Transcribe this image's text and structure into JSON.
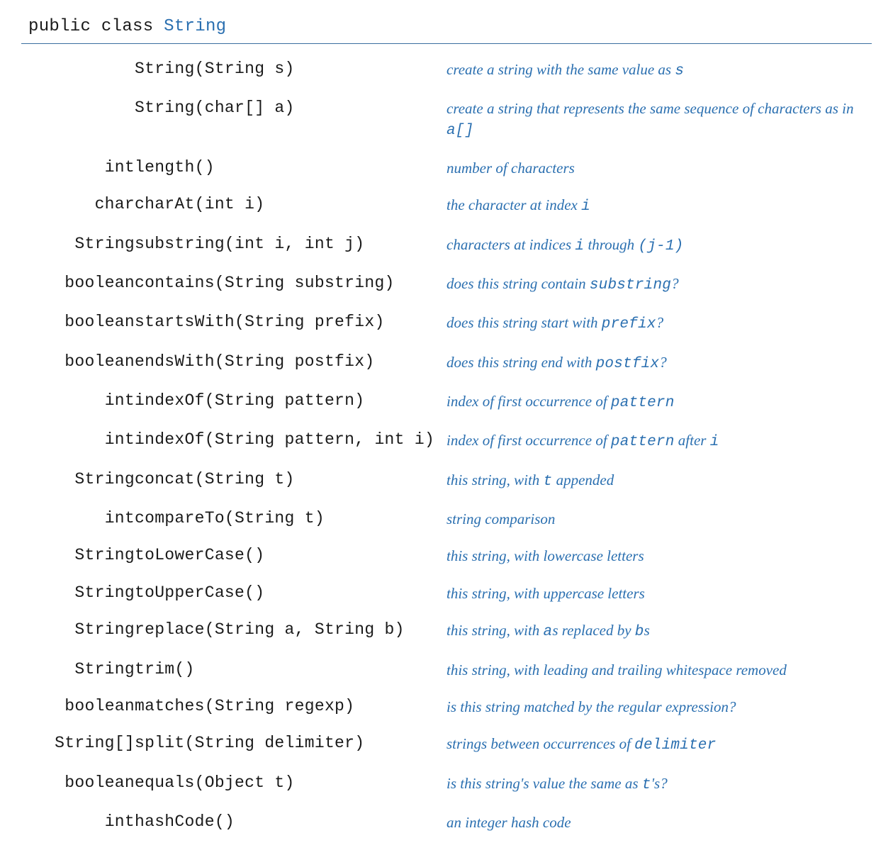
{
  "header": {
    "prefix": "public class ",
    "name": "String"
  },
  "rows": [
    {
      "ret": "",
      "sig": "String(String s)",
      "desc": "create a string with the same value as <m>s</m>"
    },
    {
      "ret": "",
      "sig": "String(char[] a)",
      "desc": "create a string that represents the same sequence of characters as in <m>a[]</m>"
    },
    {
      "ret": "int",
      "sig": "length()",
      "desc": "number of characters"
    },
    {
      "ret": "char",
      "sig": "charAt(int i)",
      "desc": "the character at index <m>i</m>"
    },
    {
      "ret": "String",
      "sig": "substring(int i, int j)",
      "desc": "characters at indices <m>i</m> through <m>(j-1)</m>"
    },
    {
      "ret": "boolean",
      "sig": "contains(String substring)",
      "desc": "does this string contain <m>substring</m>?"
    },
    {
      "ret": "boolean",
      "sig": "startsWith(String prefix)",
      "desc": "does this string start with <m>prefix</m>?"
    },
    {
      "ret": "boolean",
      "sig": "endsWith(String postfix)",
      "desc": "does this string end with <m>postfix</m>?"
    },
    {
      "ret": "int",
      "sig": "indexOf(String pattern)",
      "desc": "index of first occurrence of <m>pattern</m>"
    },
    {
      "ret": "int",
      "sig": "indexOf(String pattern, int i)",
      "desc": "index of first occurrence of <m>pattern</m> after <m>i</m>"
    },
    {
      "ret": "String",
      "sig": "concat(String t)",
      "desc": "this string, with <m>t</m> appended"
    },
    {
      "ret": "int",
      "sig": "compareTo(String t)",
      "desc": "string comparison"
    },
    {
      "ret": "String",
      "sig": "toLowerCase()",
      "desc": "this string, with lowercase letters"
    },
    {
      "ret": "String",
      "sig": "toUpperCase()",
      "desc": "this string, with uppercase letters"
    },
    {
      "ret": "String",
      "sig": "replace(String a, String b)",
      "desc": "this string, with <m>a</m>s replaced by <m>b</m>s"
    },
    {
      "ret": "String",
      "sig": "trim()",
      "desc": "this string, with leading and trailing whitespace removed"
    },
    {
      "ret": "boolean",
      "sig": "matches(String regexp)",
      "desc": "is this string matched by the regular expression?"
    },
    {
      "ret": "String[]",
      "sig": "split(String delimiter)",
      "desc": "strings between occurrences of <m>delimiter</m>"
    },
    {
      "ret": "boolean",
      "sig": "equals(Object t)",
      "desc": "is this string's value the same as <m>t</m>'s?"
    },
    {
      "ret": "int",
      "sig": "hashCode()",
      "desc": "an integer hash code"
    }
  ]
}
